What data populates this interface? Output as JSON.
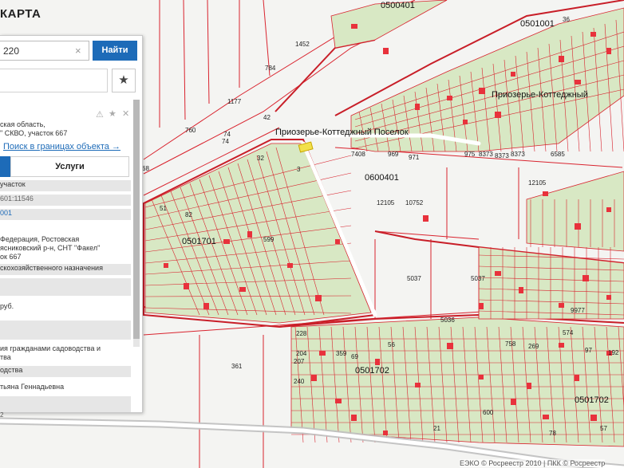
{
  "header": {
    "title": "КАРТА"
  },
  "search": {
    "value": "220",
    "clear_icon": "×",
    "button_label": "Найти",
    "star_icon": "★"
  },
  "info": {
    "address_line1": "ская область,",
    "address_line2": "\" СКВО, участок 667",
    "search_link": "Поиск в границах объекта →",
    "tab_services": "Услуги",
    "rows": [
      {
        "text": "участок",
        "style": "grey"
      },
      {
        "text": "601:11546",
        "style": "grey"
      },
      {
        "text": "001",
        "style": "link"
      },
      {
        "text": "Федерация, Ростовская",
        "style": "plain"
      },
      {
        "text": "ясниковский р-н, СНТ \"Факел\"",
        "style": "plain"
      },
      {
        "text": "ок 667",
        "style": "plain"
      },
      {
        "text": "скохозяйственного назначения",
        "style": "plain"
      },
      {
        "text": "руб.",
        "style": "plain"
      },
      {
        "text": "ия гражданами садоводства и",
        "style": "plain"
      },
      {
        "text": "тва",
        "style": "plain"
      },
      {
        "text": "одства",
        "style": "grey"
      },
      {
        "text": "тьяна Геннадьевна",
        "style": "plain"
      }
    ],
    "bottom_mark": "2"
  },
  "map": {
    "labels": [
      "0500401",
      "0501001",
      "Приозерье-Коттеджный",
      "Приозерье-Коттеджный Поселок",
      "0600401",
      "0501701",
      "0501702",
      "0501702",
      "Приозерье-Коттеджный",
      "36",
      "1452",
      "784",
      "1177",
      "760",
      "42",
      "74",
      "68",
      "74",
      "7408",
      "8373",
      "8373",
      "969",
      "971",
      "975",
      "8373",
      "6585",
      "12105",
      "12105",
      "10752",
      "5037",
      "5037",
      "5036",
      "9977",
      "574",
      "758",
      "269",
      "97",
      "192",
      "57",
      "21",
      "600",
      "78",
      "228",
      "204",
      "359",
      "69",
      "56",
      "207",
      "240",
      "361",
      "51",
      "82",
      "32",
      "599",
      "3"
    ],
    "copyright": "ЕЭКО © Росреестр 2010 | ПКК © Росреестр"
  },
  "colors": {
    "accent": "#1d6bb8",
    "parcel_border": "#d9232e",
    "parcel_fill": "#d8e8c4",
    "building": "#e8323c",
    "highlight": "#f2e04a"
  }
}
